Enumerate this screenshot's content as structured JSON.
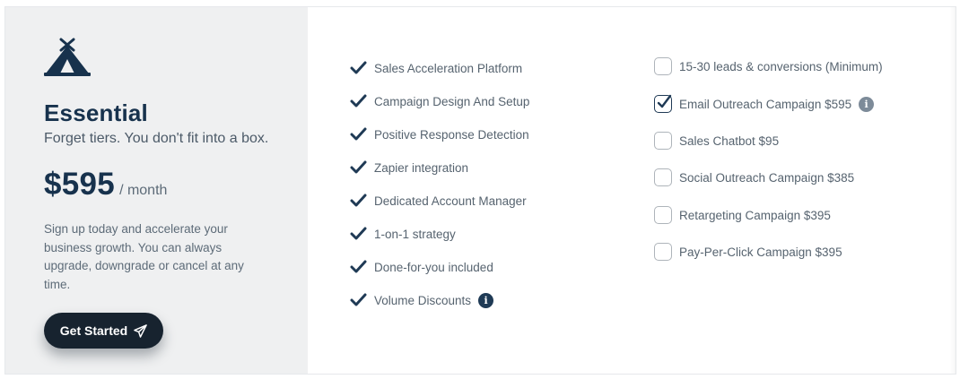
{
  "plan": {
    "name": "Essential",
    "tagline": "Forget tiers. You don't fit into a box.",
    "price": "$595",
    "period": "/ month",
    "description": "Sign up today and accelerate your business growth. You can always upgrade, downgrade or cancel at any time.",
    "cta_label": "Get Started",
    "logo_icon": "tent-icon",
    "cta_icon": "paper-plane-icon"
  },
  "features": [
    {
      "label": "Sales Acceleration Platform"
    },
    {
      "label": "Campaign Design And Setup"
    },
    {
      "label": "Positive Response Detection"
    },
    {
      "label": "Zapier integration"
    },
    {
      "label": "Dedicated Account Manager"
    },
    {
      "label": "1-on-1 strategy"
    },
    {
      "label": "Done-for-you included"
    },
    {
      "label": "Volume Discounts",
      "info": true
    }
  ],
  "addons": [
    {
      "label": "15-30 leads & conversions (Minimum)",
      "checked": false
    },
    {
      "label": "Email Outreach Campaign $595",
      "checked": true,
      "info": true
    },
    {
      "label": "Sales Chatbot $95",
      "checked": false
    },
    {
      "label": "Social Outreach Campaign $385",
      "checked": false
    },
    {
      "label": "Retargeting Campaign $395",
      "checked": false
    },
    {
      "label": "Pay-Per-Click Campaign $395",
      "checked": false
    }
  ],
  "colors": {
    "primary": "#17324d",
    "button": "#17232f",
    "panel": "#eff0f1",
    "text": "#56636f"
  }
}
